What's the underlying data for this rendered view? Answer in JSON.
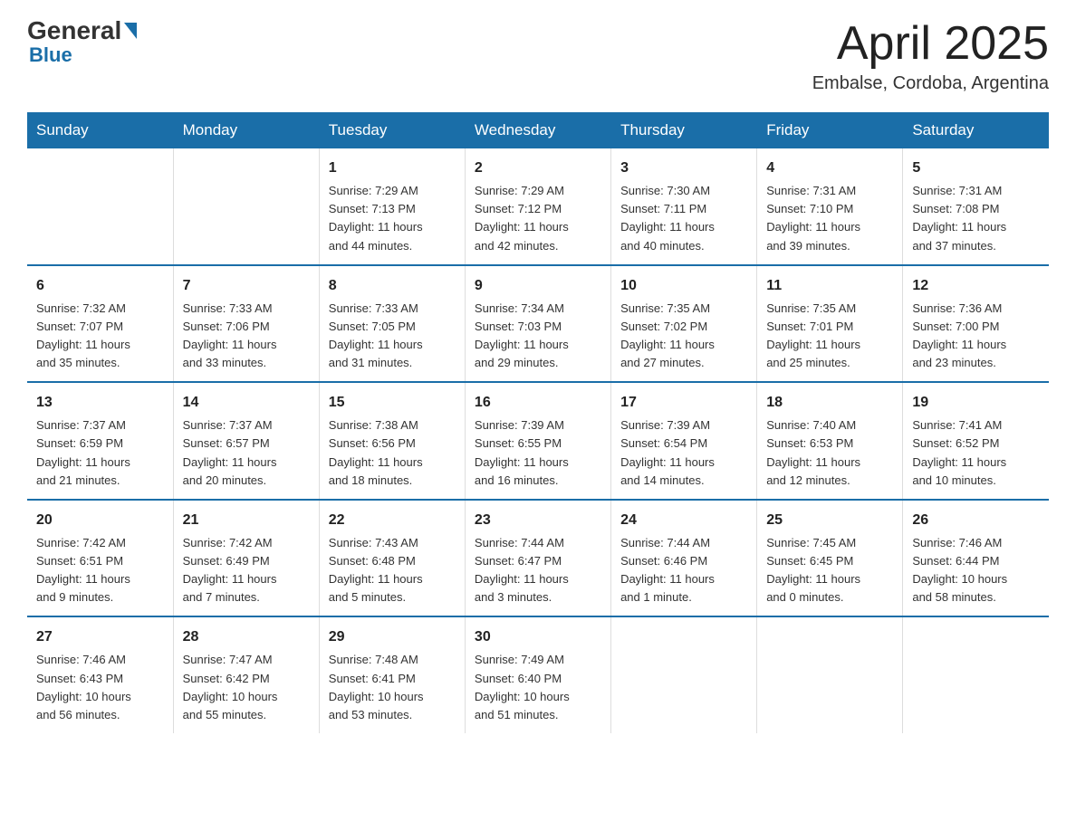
{
  "header": {
    "logo": {
      "general": "General",
      "blue": "Blue"
    },
    "title": "April 2025",
    "location": "Embalse, Cordoba, Argentina"
  },
  "columns": [
    "Sunday",
    "Monday",
    "Tuesday",
    "Wednesday",
    "Thursday",
    "Friday",
    "Saturday"
  ],
  "weeks": [
    [
      {
        "day": "",
        "info": ""
      },
      {
        "day": "",
        "info": ""
      },
      {
        "day": "1",
        "info": "Sunrise: 7:29 AM\nSunset: 7:13 PM\nDaylight: 11 hours\nand 44 minutes."
      },
      {
        "day": "2",
        "info": "Sunrise: 7:29 AM\nSunset: 7:12 PM\nDaylight: 11 hours\nand 42 minutes."
      },
      {
        "day": "3",
        "info": "Sunrise: 7:30 AM\nSunset: 7:11 PM\nDaylight: 11 hours\nand 40 minutes."
      },
      {
        "day": "4",
        "info": "Sunrise: 7:31 AM\nSunset: 7:10 PM\nDaylight: 11 hours\nand 39 minutes."
      },
      {
        "day": "5",
        "info": "Sunrise: 7:31 AM\nSunset: 7:08 PM\nDaylight: 11 hours\nand 37 minutes."
      }
    ],
    [
      {
        "day": "6",
        "info": "Sunrise: 7:32 AM\nSunset: 7:07 PM\nDaylight: 11 hours\nand 35 minutes."
      },
      {
        "day": "7",
        "info": "Sunrise: 7:33 AM\nSunset: 7:06 PM\nDaylight: 11 hours\nand 33 minutes."
      },
      {
        "day": "8",
        "info": "Sunrise: 7:33 AM\nSunset: 7:05 PM\nDaylight: 11 hours\nand 31 minutes."
      },
      {
        "day": "9",
        "info": "Sunrise: 7:34 AM\nSunset: 7:03 PM\nDaylight: 11 hours\nand 29 minutes."
      },
      {
        "day": "10",
        "info": "Sunrise: 7:35 AM\nSunset: 7:02 PM\nDaylight: 11 hours\nand 27 minutes."
      },
      {
        "day": "11",
        "info": "Sunrise: 7:35 AM\nSunset: 7:01 PM\nDaylight: 11 hours\nand 25 minutes."
      },
      {
        "day": "12",
        "info": "Sunrise: 7:36 AM\nSunset: 7:00 PM\nDaylight: 11 hours\nand 23 minutes."
      }
    ],
    [
      {
        "day": "13",
        "info": "Sunrise: 7:37 AM\nSunset: 6:59 PM\nDaylight: 11 hours\nand 21 minutes."
      },
      {
        "day": "14",
        "info": "Sunrise: 7:37 AM\nSunset: 6:57 PM\nDaylight: 11 hours\nand 20 minutes."
      },
      {
        "day": "15",
        "info": "Sunrise: 7:38 AM\nSunset: 6:56 PM\nDaylight: 11 hours\nand 18 minutes."
      },
      {
        "day": "16",
        "info": "Sunrise: 7:39 AM\nSunset: 6:55 PM\nDaylight: 11 hours\nand 16 minutes."
      },
      {
        "day": "17",
        "info": "Sunrise: 7:39 AM\nSunset: 6:54 PM\nDaylight: 11 hours\nand 14 minutes."
      },
      {
        "day": "18",
        "info": "Sunrise: 7:40 AM\nSunset: 6:53 PM\nDaylight: 11 hours\nand 12 minutes."
      },
      {
        "day": "19",
        "info": "Sunrise: 7:41 AM\nSunset: 6:52 PM\nDaylight: 11 hours\nand 10 minutes."
      }
    ],
    [
      {
        "day": "20",
        "info": "Sunrise: 7:42 AM\nSunset: 6:51 PM\nDaylight: 11 hours\nand 9 minutes."
      },
      {
        "day": "21",
        "info": "Sunrise: 7:42 AM\nSunset: 6:49 PM\nDaylight: 11 hours\nand 7 minutes."
      },
      {
        "day": "22",
        "info": "Sunrise: 7:43 AM\nSunset: 6:48 PM\nDaylight: 11 hours\nand 5 minutes."
      },
      {
        "day": "23",
        "info": "Sunrise: 7:44 AM\nSunset: 6:47 PM\nDaylight: 11 hours\nand 3 minutes."
      },
      {
        "day": "24",
        "info": "Sunrise: 7:44 AM\nSunset: 6:46 PM\nDaylight: 11 hours\nand 1 minute."
      },
      {
        "day": "25",
        "info": "Sunrise: 7:45 AM\nSunset: 6:45 PM\nDaylight: 11 hours\nand 0 minutes."
      },
      {
        "day": "26",
        "info": "Sunrise: 7:46 AM\nSunset: 6:44 PM\nDaylight: 10 hours\nand 58 minutes."
      }
    ],
    [
      {
        "day": "27",
        "info": "Sunrise: 7:46 AM\nSunset: 6:43 PM\nDaylight: 10 hours\nand 56 minutes."
      },
      {
        "day": "28",
        "info": "Sunrise: 7:47 AM\nSunset: 6:42 PM\nDaylight: 10 hours\nand 55 minutes."
      },
      {
        "day": "29",
        "info": "Sunrise: 7:48 AM\nSunset: 6:41 PM\nDaylight: 10 hours\nand 53 minutes."
      },
      {
        "day": "30",
        "info": "Sunrise: 7:49 AM\nSunset: 6:40 PM\nDaylight: 10 hours\nand 51 minutes."
      },
      {
        "day": "",
        "info": ""
      },
      {
        "day": "",
        "info": ""
      },
      {
        "day": "",
        "info": ""
      }
    ]
  ]
}
